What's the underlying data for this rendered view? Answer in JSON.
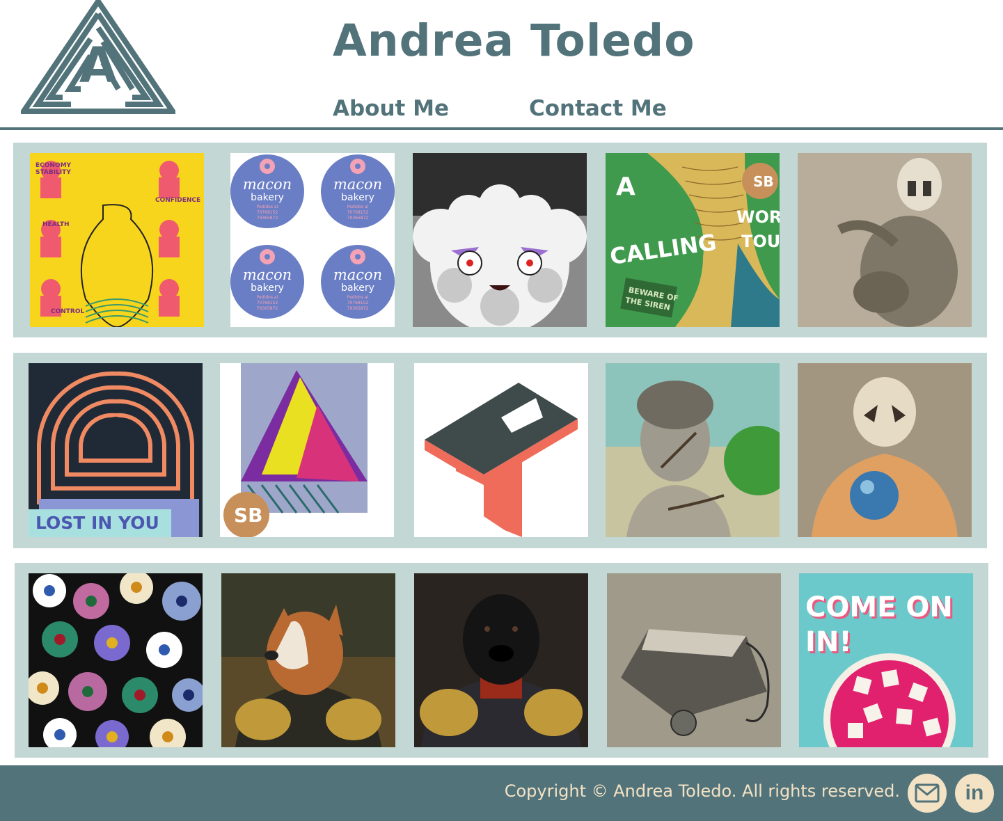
{
  "header": {
    "title": "Andrea Toledo",
    "logo_icon": "maze-letter-a-logo",
    "nav": [
      {
        "label": "About Me"
      },
      {
        "label": "Contact Me"
      }
    ]
  },
  "gallery": {
    "rows": [
      {
        "items": [
          {
            "icon": "uterus-pattern-artwork",
            "words": [
              "ECONOMY",
              "STABILITY",
              "CONFIDENCE",
              "HEALTH",
              "CONTROL"
            ]
          },
          {
            "icon": "bakery-sticker-artwork",
            "brand": "macon",
            "sub": "bakery",
            "line1": "Pedidos al",
            "line2": "70768152",
            "line3": "79365872"
          },
          {
            "icon": "fluffy-monster-artwork"
          },
          {
            "icon": "mermaid-tail-poster-artwork",
            "a": "A",
            "calling": "CALLING",
            "world": "WORLD",
            "tour": "TOUR",
            "beware": "BEWARE OF",
            "siren": "THE SIREN",
            "badge": "SB"
          },
          {
            "icon": "masked-figure-drawing"
          }
        ]
      },
      {
        "items": [
          {
            "icon": "keyhole-maze-artwork",
            "caption": "LOST IN YOU"
          },
          {
            "icon": "abstract-tree-artwork",
            "badge": "SB"
          },
          {
            "icon": "isometric-letters-logo"
          },
          {
            "icon": "boy-statue-painting"
          },
          {
            "icon": "owl-mask-figure-painting"
          }
        ]
      },
      {
        "items": [
          {
            "icon": "daisy-pattern-artwork"
          },
          {
            "icon": "dog-general-portrait"
          },
          {
            "icon": "black-dog-general-portrait"
          },
          {
            "icon": "bag-and-ball-drawing"
          },
          {
            "icon": "come-on-in-poster",
            "line1": "COME ON",
            "line2": "IN!"
          }
        ]
      }
    ]
  },
  "footer": {
    "copyright": "Copyright © Andrea Toledo. All rights reserved.",
    "email_icon": "email-icon",
    "linkedin_icon": "linkedin-icon",
    "linkedin_text": "in"
  },
  "colors": {
    "primary": "#52737a",
    "row_bg": "#c3d8d5",
    "footer_text": "#f3e2c4"
  }
}
